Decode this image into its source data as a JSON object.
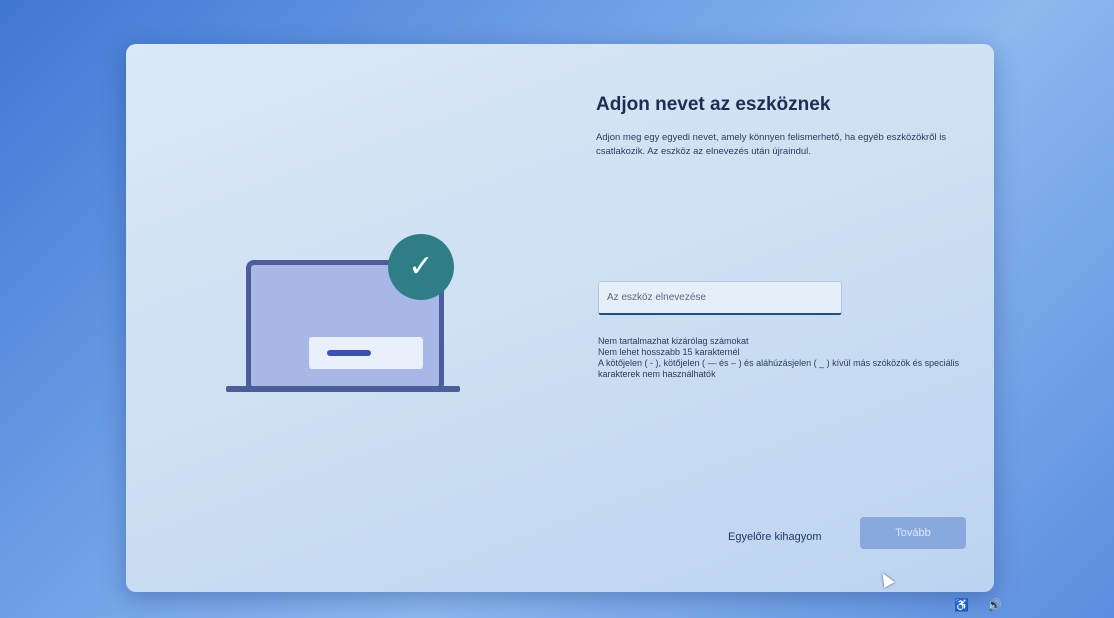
{
  "dialog": {
    "title": "Adjon nevet az eszköznek",
    "description": "Adjon meg egy egyedi nevet, amely könnyen felismerhető, ha egyéb eszközökről is csatlakozik. Az eszköz az elnevezés után újraindul.",
    "input_placeholder": "Az eszköz elnevezése",
    "input_value": "",
    "rules": [
      "Nem tartalmazhat kizárólag számokat",
      "Nem lehet hosszabb 15 karakternél",
      "A kötőjelen ( - ), kötőjelen ( — és – ) és aláhúzásjelen ( _ ) kívül más szóközök és speciális karakterek nem használhatók"
    ],
    "skip_label": "Egyelőre kihagyom",
    "next_label": "Tovább"
  },
  "illustration": {
    "check_glyph": "✓",
    "icons": [
      "laptop-icon",
      "checkmark-icon"
    ]
  },
  "tray": {
    "icons": [
      "accessibility-icon",
      "volume-icon"
    ],
    "accessibility_glyph": "♿",
    "volume_glyph": "🔊"
  },
  "colors": {
    "accent": "#1e4f9c",
    "badge": "#2f7d86",
    "button_disabled": "#88a8de"
  }
}
